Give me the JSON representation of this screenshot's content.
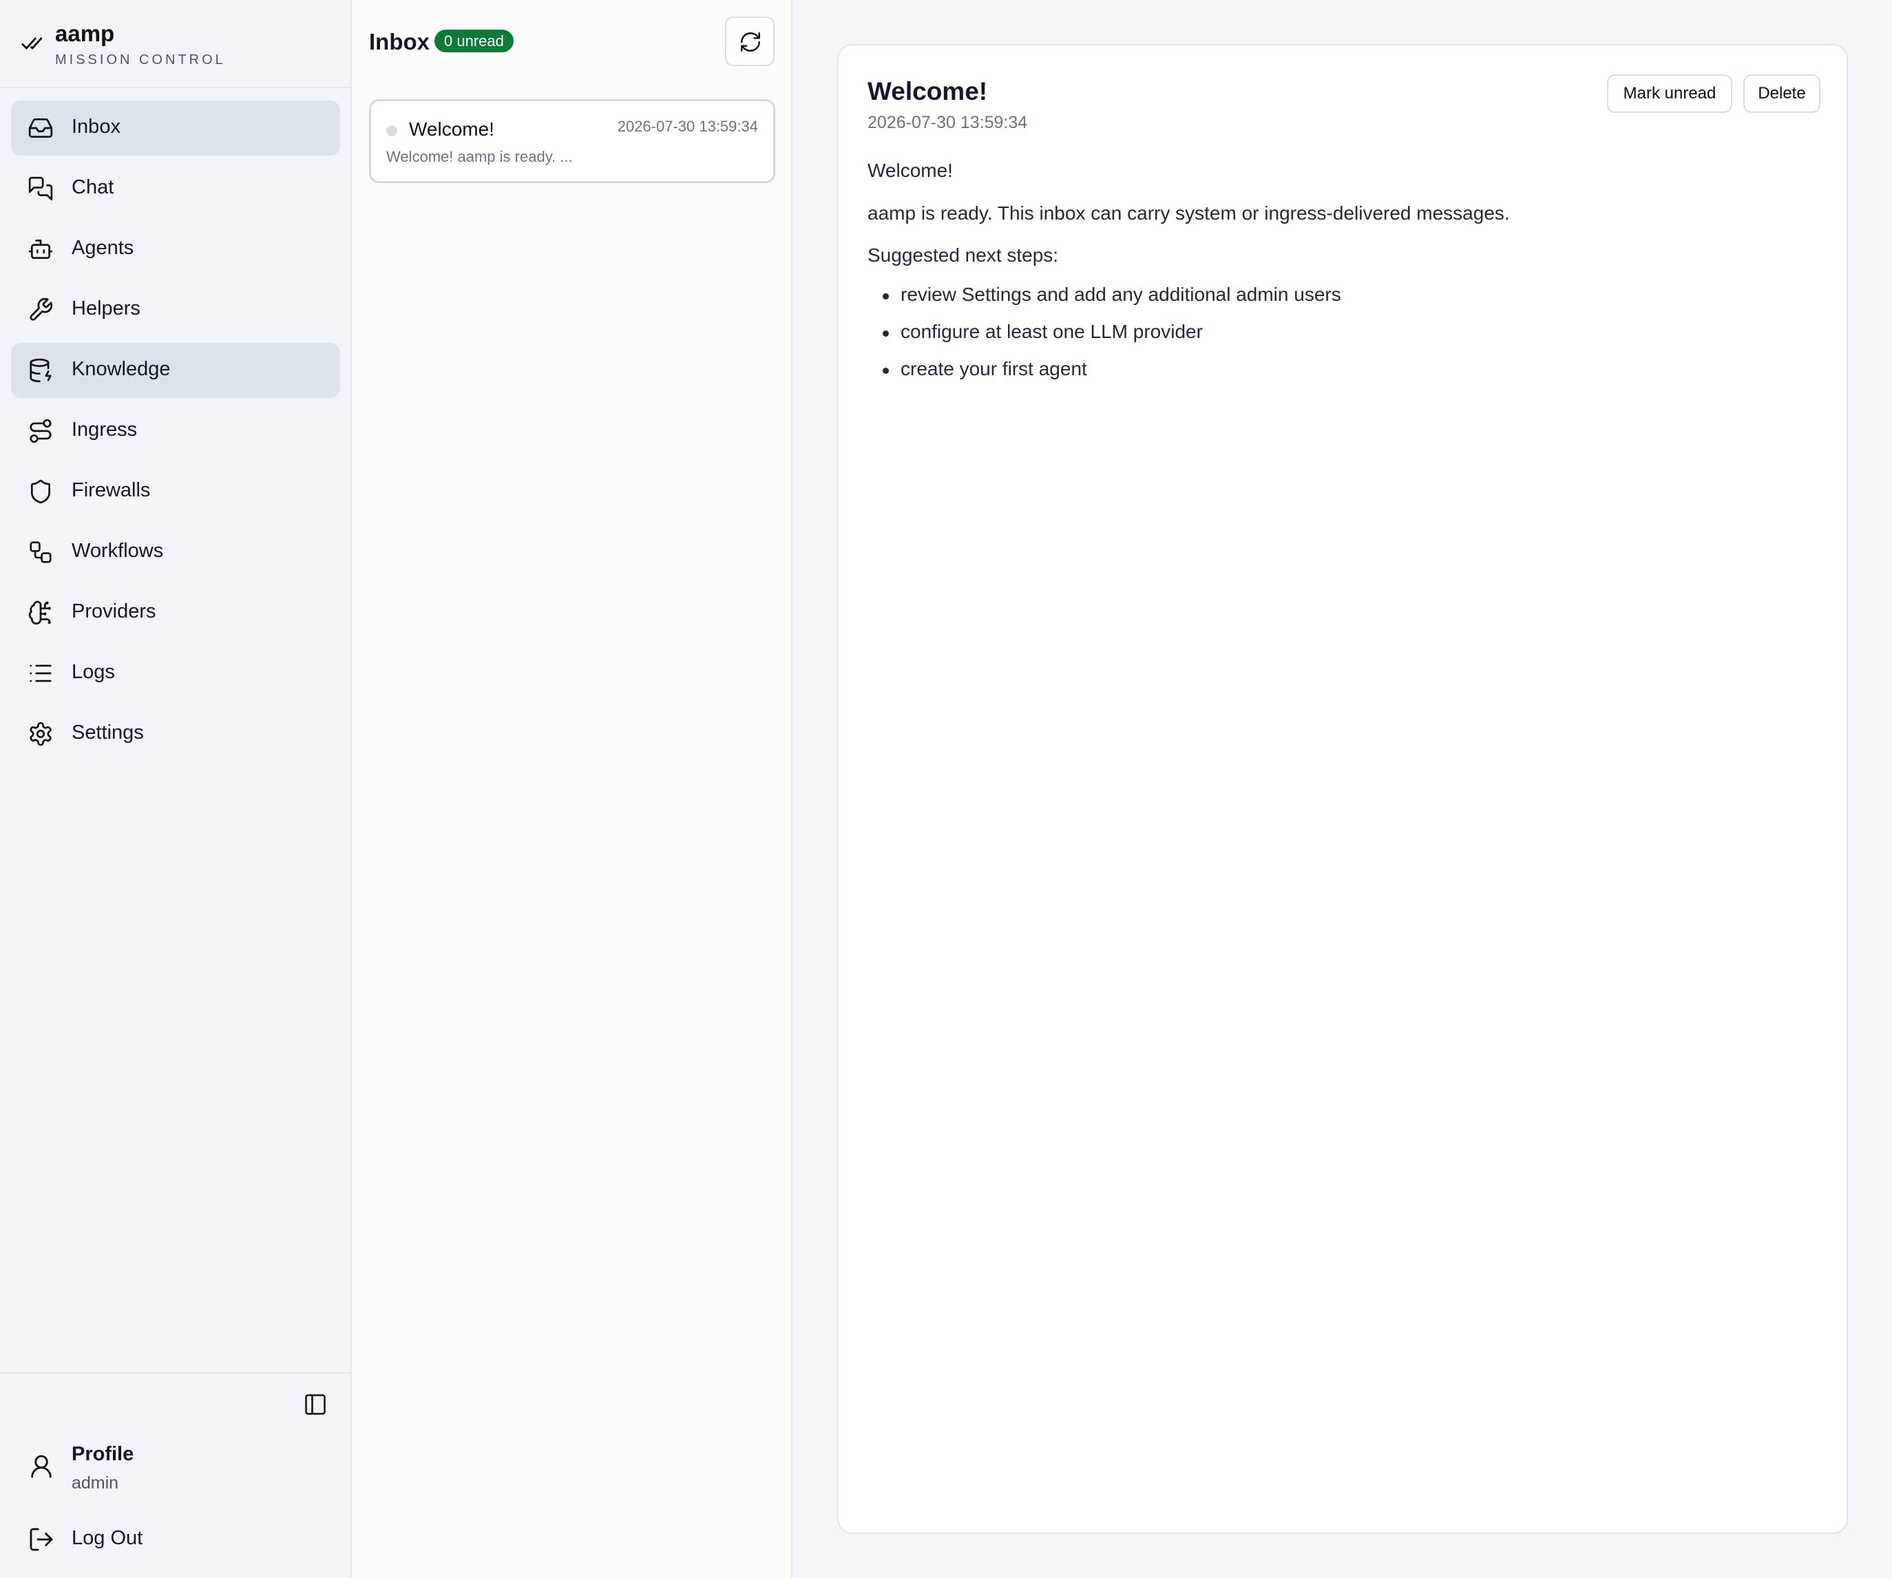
{
  "brand": {
    "name": "aamp",
    "subtitle": "MISSION CONTROL"
  },
  "sidebar": {
    "items": [
      {
        "label": "Inbox",
        "icon": "inbox-icon",
        "active": true
      },
      {
        "label": "Chat",
        "icon": "chat-icon",
        "active": false
      },
      {
        "label": "Agents",
        "icon": "bot-icon",
        "active": false
      },
      {
        "label": "Helpers",
        "icon": "wrench-icon",
        "active": false
      },
      {
        "label": "Knowledge",
        "icon": "database-icon",
        "active": true
      },
      {
        "label": "Ingress",
        "icon": "route-icon",
        "active": false
      },
      {
        "label": "Firewalls",
        "icon": "shield-icon",
        "active": false
      },
      {
        "label": "Workflows",
        "icon": "workflow-icon",
        "active": false
      },
      {
        "label": "Providers",
        "icon": "brain-icon",
        "active": false
      },
      {
        "label": "Logs",
        "icon": "list-icon",
        "active": false
      },
      {
        "label": "Settings",
        "icon": "gear-icon",
        "active": false
      }
    ],
    "profile": {
      "name": "Profile",
      "role": "admin"
    },
    "logout_label": "Log Out"
  },
  "inbox": {
    "title": "Inbox",
    "unread_badge": "0 unread",
    "messages": [
      {
        "title": "Welcome!",
        "time": "2026-07-30 13:59:34",
        "preview": "Welcome! aamp is ready. ..."
      }
    ]
  },
  "detail": {
    "title": "Welcome!",
    "date": "2026-07-30 13:59:34",
    "mark_unread_label": "Mark unread",
    "delete_label": "Delete",
    "paragraphs": [
      "Welcome!",
      "aamp is ready. This inbox can carry system or ingress-delivered messages.",
      "Suggested next steps:"
    ],
    "steps": [
      "review Settings and add any additional admin users",
      "configure at least one LLM provider",
      "create your first agent"
    ]
  },
  "colors": {
    "accent_green": "#0f7a37",
    "active_nav": "#dde3ea",
    "sidebar_bg": "#f1f4f9"
  }
}
